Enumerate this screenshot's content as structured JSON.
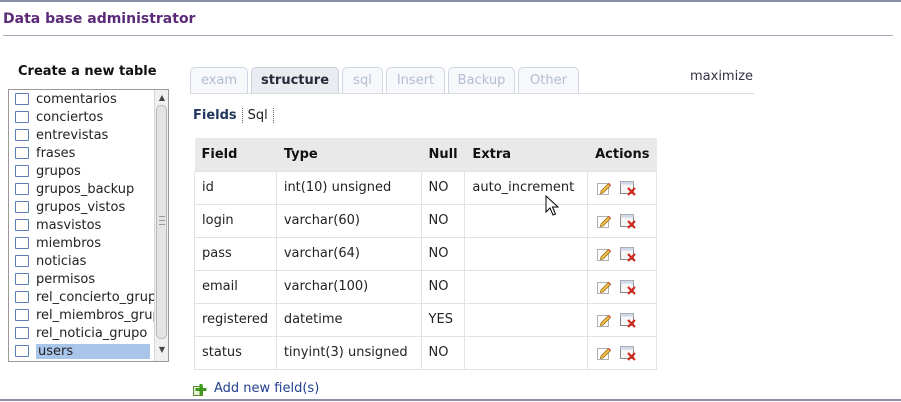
{
  "app": {
    "title": "Data base administrator"
  },
  "sidebar": {
    "title": "Create a new table",
    "tables": [
      "comentarios",
      "conciertos",
      "entrevistas",
      "frases",
      "grupos",
      "grupos_backup",
      "grupos_vistos",
      "masvistos",
      "miembros",
      "noticias",
      "permisos",
      "rel_concierto_grupo",
      "rel_miembros_grupo",
      "rel_noticia_grupo",
      "users"
    ],
    "selected": "users"
  },
  "tabs": [
    {
      "label": "exam",
      "active": false
    },
    {
      "label": "structure",
      "active": true
    },
    {
      "label": "sql",
      "active": false
    },
    {
      "label": "Insert",
      "active": false
    },
    {
      "label": "Backup",
      "active": false
    },
    {
      "label": "Other",
      "active": false
    }
  ],
  "maximize_label": "maximize",
  "subnav": {
    "fields": "Fields",
    "sql": "Sql"
  },
  "grid": {
    "headers": [
      "Field",
      "Type",
      "Null",
      "Extra",
      "Actions"
    ],
    "rows": [
      {
        "field": "id",
        "type": "int(10) unsigned",
        "null": "NO",
        "extra": "auto_increment"
      },
      {
        "field": "login",
        "type": "varchar(60)",
        "null": "NO",
        "extra": ""
      },
      {
        "field": "pass",
        "type": "varchar(64)",
        "null": "NO",
        "extra": ""
      },
      {
        "field": "email",
        "type": "varchar(100)",
        "null": "NO",
        "extra": ""
      },
      {
        "field": "registered",
        "type": "datetime",
        "null": "YES",
        "extra": ""
      },
      {
        "field": "status",
        "type": "tinyint(3) unsigned",
        "null": "NO",
        "extra": ""
      }
    ]
  },
  "add_field_label": "Add new field(s)",
  "colors": {
    "title": "#5b2b7a",
    "link": "#23408e",
    "header_bg": "#e9e9e9",
    "selected_bg": "#a9c5ea"
  }
}
